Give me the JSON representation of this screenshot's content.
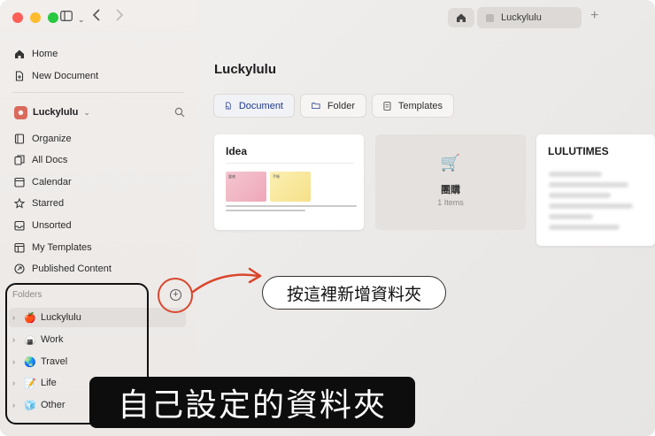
{
  "colors": {
    "accent": "#1e3a8a",
    "annotation_red": "#d9472e",
    "traffic_red": "#fe5f57",
    "traffic_yellow": "#febc2e",
    "traffic_green": "#28c840"
  },
  "toolbar": {
    "sidebar_toggle_icon": "sidebar-icon",
    "back_icon": "chevron-left-icon",
    "forward_icon": "chevron-right-icon",
    "tab_title": "Luckylulu",
    "new_tab_icon": "plus-icon"
  },
  "sidebar": {
    "top_items": [
      {
        "label": "Home",
        "icon": "house-icon"
      },
      {
        "label": "New Document",
        "icon": "new-document-icon"
      }
    ],
    "workspace": {
      "name": "Luckylulu",
      "icon": "search-icon"
    },
    "items": [
      {
        "label": "Organize",
        "icon": "organize-icon"
      },
      {
        "label": "All Docs",
        "icon": "docs-icon"
      },
      {
        "label": "Calendar",
        "icon": "calendar-icon"
      },
      {
        "label": "Starred",
        "icon": "star-icon"
      },
      {
        "label": "Unsorted",
        "icon": "tray-icon"
      },
      {
        "label": "My Templates",
        "icon": "templates-icon"
      },
      {
        "label": "Published Content",
        "icon": "share-icon"
      }
    ],
    "folders_title": "Folders",
    "folders": [
      {
        "label": "Luckylulu",
        "emoji": "🍎"
      },
      {
        "label": "Work",
        "emoji": "🍙"
      },
      {
        "label": "Travel",
        "emoji": "🌏"
      },
      {
        "label": "Life",
        "emoji": "📝"
      },
      {
        "label": "Other",
        "emoji": "🧊"
      }
    ]
  },
  "main": {
    "title": "Luckylulu",
    "actions": [
      {
        "label": "Document",
        "icon": "document-icon"
      },
      {
        "label": "Folder",
        "icon": "folder-icon"
      },
      {
        "label": "Templates",
        "icon": "template-icon"
      }
    ],
    "cards": [
      {
        "title": "Idea",
        "thumb_a": "靈感",
        "thumb_b": "手帳"
      },
      {
        "title": "團購",
        "count": "1 Items",
        "icon": "cart-icon"
      },
      {
        "title": "LULUTIMES"
      }
    ]
  },
  "annotations": {
    "callout": "按這裡新增資料夾",
    "banner": "自己設定的資料夾"
  }
}
